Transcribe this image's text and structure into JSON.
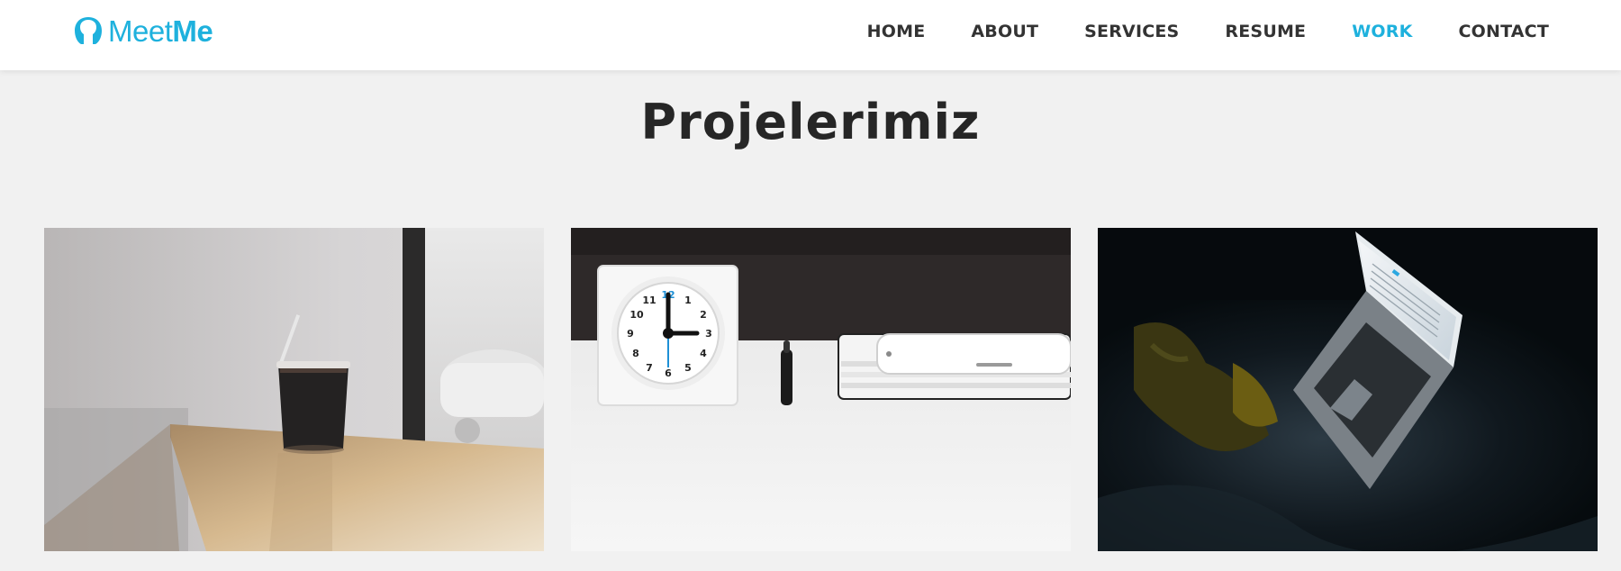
{
  "brand": {
    "name_light": "Meet",
    "name_bold": "Me",
    "color": "#1eb1dd",
    "icon": "person-icon"
  },
  "nav": {
    "items": [
      {
        "label": "HOME",
        "active": false
      },
      {
        "label": "ABOUT",
        "active": false
      },
      {
        "label": "SERVICES",
        "active": false
      },
      {
        "label": "RESUME",
        "active": false
      },
      {
        "label": "WORK",
        "active": true
      },
      {
        "label": "CONTACT",
        "active": false
      }
    ]
  },
  "section": {
    "title": "Projelerimiz"
  },
  "clock": {
    "numbers": [
      "12",
      "1",
      "2",
      "3",
      "4",
      "5",
      "6",
      "7",
      "8",
      "9",
      "10",
      "11"
    ]
  },
  "colors": {
    "text_dark": "#262626",
    "background": "#f1f1f1",
    "accent": "#1eb1dd"
  }
}
